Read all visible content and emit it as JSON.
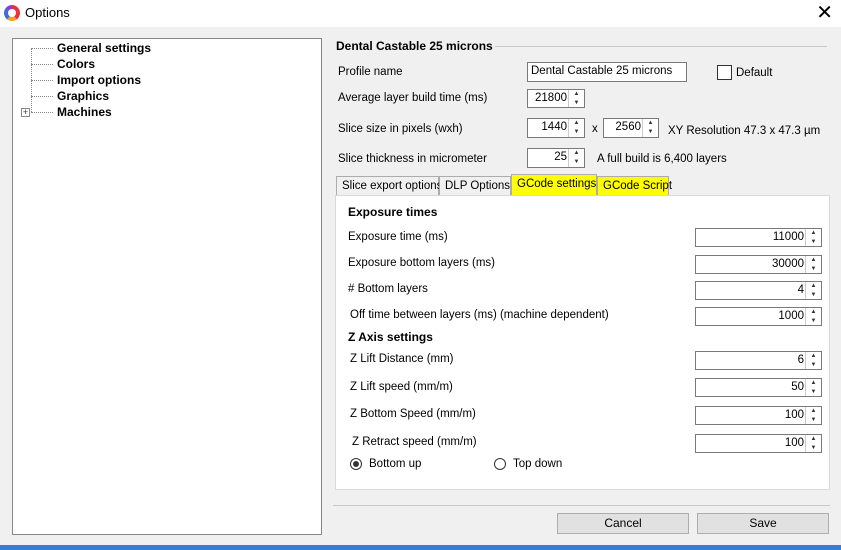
{
  "window": {
    "title": "Options"
  },
  "tree": {
    "items": [
      "General settings",
      "Colors",
      "Import options",
      "Graphics",
      "Machines"
    ]
  },
  "profile": {
    "section_title": "Dental Castable 25 microns",
    "name_label": "Profile name",
    "name_value": "Dental Castable 25 microns",
    "default_label": "Default",
    "avg_build_label": "Average layer build time (ms)",
    "avg_build_value": "21800",
    "slice_size_label": "Slice size in pixels (wxh)",
    "slice_w": "1440",
    "x_sep": "x",
    "slice_h": "2560",
    "xy_resolution": "XY Resolution 47.3 x 47.3 µm",
    "thickness_label": "Slice thickness in micrometer",
    "thickness_value": "25",
    "full_build": "A full build is 6,400 layers"
  },
  "tabs": [
    "Slice export options",
    "DLP Options",
    "GCode settings",
    "GCode Script"
  ],
  "gcode": {
    "exposure_head": "Exposure times",
    "exposure_time_label": "Exposure time (ms)",
    "exposure_time_value": "11000",
    "exposure_bottom_label": "Exposure bottom layers (ms)",
    "exposure_bottom_value": "30000",
    "bottom_layers_label": "# Bottom layers",
    "bottom_layers_value": "4",
    "off_time_label": "Off time between layers (ms) (machine dependent)",
    "off_time_value": "1000",
    "zaxis_head": "Z Axis settings",
    "z_lift_dist_label": "Z Lift Distance (mm)",
    "z_lift_dist_value": "6",
    "z_lift_speed_label": "Z Lift speed (mm/m)",
    "z_lift_speed_value": "50",
    "z_bottom_speed_label": "Z Bottom Speed (mm/m)",
    "z_bottom_speed_value": "100",
    "z_retract_label": "Z Retract speed (mm/m)",
    "z_retract_value": "100",
    "radio_bottom_up": "Bottom up",
    "radio_top_down": "Top down"
  },
  "buttons": {
    "cancel": "Cancel",
    "save": "Save"
  },
  "colors": {
    "highlight": "#ffff00",
    "accent": "#3a7bd5"
  }
}
